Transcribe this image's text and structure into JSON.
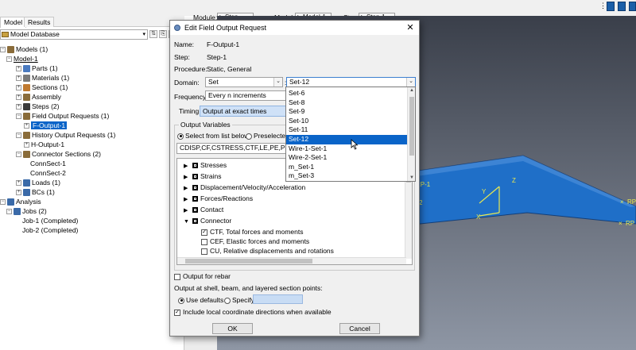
{
  "context_bar": {
    "module_label": "Module:",
    "module_value": "Step",
    "model_label": "Model:",
    "model_value": "Model-1",
    "step_label": "Step:",
    "step_value": "Step-1"
  },
  "left_panel": {
    "tabs": [
      "Model",
      "Results"
    ],
    "database_selector": "Model Database",
    "tree": [
      {
        "label": "Models (1)"
      },
      {
        "label": "Model-1"
      },
      {
        "label": "Parts (1)"
      },
      {
        "label": "Materials (1)"
      },
      {
        "label": "Sections (1)"
      },
      {
        "label": "Assembly"
      },
      {
        "label": "Steps (2)"
      },
      {
        "label": "Field Output Requests (1)"
      },
      {
        "label": "F-Output-1"
      },
      {
        "label": "History Output Requests (1)"
      },
      {
        "label": "H-Output-1"
      },
      {
        "label": "Connector Sections (2)"
      },
      {
        "label": "ConnSect-1"
      },
      {
        "label": "ConnSect-2"
      },
      {
        "label": "Loads (1)"
      },
      {
        "label": "BCs (1)"
      },
      {
        "label": "Analysis"
      },
      {
        "label": "Jobs (2)"
      },
      {
        "label": "Job-1 (Completed)"
      },
      {
        "label": "Job-2 (Completed)"
      }
    ]
  },
  "viewport": {
    "labels": [
      "RP-1",
      "RP-",
      "RP",
      "2"
    ],
    "triad": {
      "y": "Y",
      "z": "Z",
      "x": "X"
    }
  },
  "dialog": {
    "title": "Edit Field Output Request",
    "name_label": "Name:",
    "name_value": "F-Output-1",
    "step_label": "Step:",
    "step_value": "Step-1",
    "procedure_label": "Procedure:",
    "procedure_value": "Static, General",
    "domain_label": "Domain:",
    "domain_value": "Set",
    "domain_sep": ":",
    "set_value": "Set-12",
    "frequency_label": "Frequency:",
    "frequency_value": "Every n increments",
    "timing_label": "Timing:",
    "timing_value": "Output at exact times",
    "output_variables_label": "Output Variables",
    "radio_select_label": "Select from list below",
    "radio_preselected_label": "Preselected d",
    "variables_text": "CDISP,CF,CSTRESS,CTF,LE,PE,PEEQ,PEMAG",
    "variables": [
      {
        "label": "Stresses",
        "expanded": false
      },
      {
        "label": "Strains",
        "expanded": false
      },
      {
        "label": "Displacement/Velocity/Acceleration",
        "expanded": false
      },
      {
        "label": "Forces/Reactions",
        "expanded": false
      },
      {
        "label": "Contact",
        "expanded": false
      },
      {
        "label": "Connector",
        "expanded": true
      }
    ],
    "connector_children": [
      {
        "label": "CTF, Total forces and moments",
        "checked": true
      },
      {
        "label": "CEF, Elastic forces and moments",
        "checked": false
      },
      {
        "label": "CU, Relative displacements and rotations",
        "checked": false
      },
      {
        "label": "CUE, Elastic displacements and rotations",
        "checked": false
      }
    ],
    "rebar_label": "Output for rebar",
    "section_points_label": "Output at shell, beam, and layered section points:",
    "use_defaults_label": "Use defaults",
    "specify_label": "Specify:",
    "include_local_label": "Include local coordinate directions when available",
    "ok_label": "OK",
    "cancel_label": "Cancel"
  },
  "set_dropdown": {
    "items": [
      "Set-6",
      "Set-8",
      "Set-9",
      "Set-10",
      "Set-11",
      "Set-12",
      "Wire-1-Set-1",
      "Wire-2-Set-1",
      "m_Set-1",
      "m_Set-3"
    ],
    "selected": "Set-12"
  },
  "colors": {
    "selection": "#0a64c8",
    "plate": "#1f6fc8",
    "viewport_top": "#3a3f4a",
    "viewport_bottom": "#8e96a4"
  }
}
